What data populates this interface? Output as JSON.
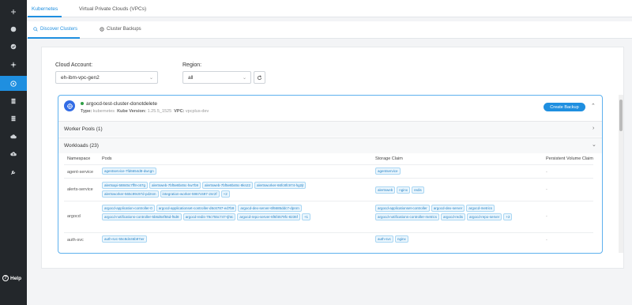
{
  "sidebar": {
    "items": [
      {
        "icon": "plus-icon"
      },
      {
        "icon": "dashboard-icon"
      },
      {
        "icon": "check-icon"
      },
      {
        "icon": "network-icon"
      },
      {
        "icon": "kubernetes-icon",
        "active": true
      },
      {
        "icon": "server-icon"
      },
      {
        "icon": "database-icon"
      },
      {
        "icon": "cloud-icon"
      },
      {
        "icon": "cloud-upload-icon"
      },
      {
        "icon": "wrench-icon"
      }
    ],
    "help_label": "Help"
  },
  "top_tabs": [
    {
      "label": "Kubernetes",
      "active": true
    },
    {
      "label": "Virtual Private Clouds (VPCs)",
      "active": false
    }
  ],
  "sub_tabs": [
    {
      "label": "Discover Clusters",
      "active": true
    },
    {
      "label": "Cluster Backups",
      "active": false
    }
  ],
  "filters": {
    "cloud_account_label": "Cloud Account:",
    "cloud_account_value": "eh-ibm-vpc-gen2",
    "region_label": "Region:",
    "region_value": "all"
  },
  "cluster": {
    "name": "argocd-test-cluster-donotdelete",
    "type_label": "Type:",
    "type_value": "kubernetes",
    "kube_label": "Kube Version:",
    "kube_value": "1.25.5_1525",
    "vpc_label": "VPC:",
    "vpc_value": "vpcplus-dev",
    "create_backup_label": "Create Backup",
    "status_color": "#2e9e44"
  },
  "sections": {
    "worker_pools": "Worker Pools (1)",
    "workloads": "Workloads (23)"
  },
  "workloads_table": {
    "headers": [
      "Namespace",
      "Pods",
      "Storage Claim",
      "Persistent Volume Claim"
    ],
    "rows": [
      {
        "namespace": "agent-service",
        "pods": [
          "agentservice-7fd6654d8-dwcgn"
        ],
        "claims": [
          "agentservice"
        ],
        "pvc": "-"
      },
      {
        "namespace": "alerts-service",
        "pods": [
          "alertsapi-58845c7ff8-c67g",
          "alertsweb-7bf5e8b46c-hw7b9",
          "alertsweb-7bf5e8b46c-9kn22",
          "alertsworker-66fc8fc974-hg2jt",
          "alertsworker-565c99c97d-pd2sm",
          "integration-worker-5967c697-2nr2f",
          "+2"
        ],
        "claims": [
          "alertsweb",
          "nginx",
          "redis"
        ],
        "pvc": "-"
      },
      {
        "namespace": "argocd",
        "pods": [
          "argocd-application-controller-0",
          "argocd-applicationset-controller-d6c6787-ed7b9",
          "argocd-dex-server-6f6685ddc7-dpnrn",
          "argocd-notifications-controller-5b6d64f55d-f5d8",
          "argocd-redis-79c755c747-tjhtc",
          "argocd-repo-server-6f6f4579fc-8236f",
          "+1"
        ],
        "claims": [
          "argocd-applicationset-controller",
          "argocd-dex-server",
          "argocd-metrics",
          "argocd-notifications-controller-metrics",
          "argocd-redis",
          "argocd-repo-server",
          "+2"
        ],
        "pvc": "-"
      },
      {
        "namespace": "auth-svc",
        "pods": [
          "auth-svc-55c8d446b97wr"
        ],
        "claims": [
          "auth-svc",
          "nginx"
        ],
        "pvc": "-"
      }
    ]
  },
  "colors": {
    "accent": "#1f8fe0",
    "sidebar_bg": "#23272b"
  }
}
